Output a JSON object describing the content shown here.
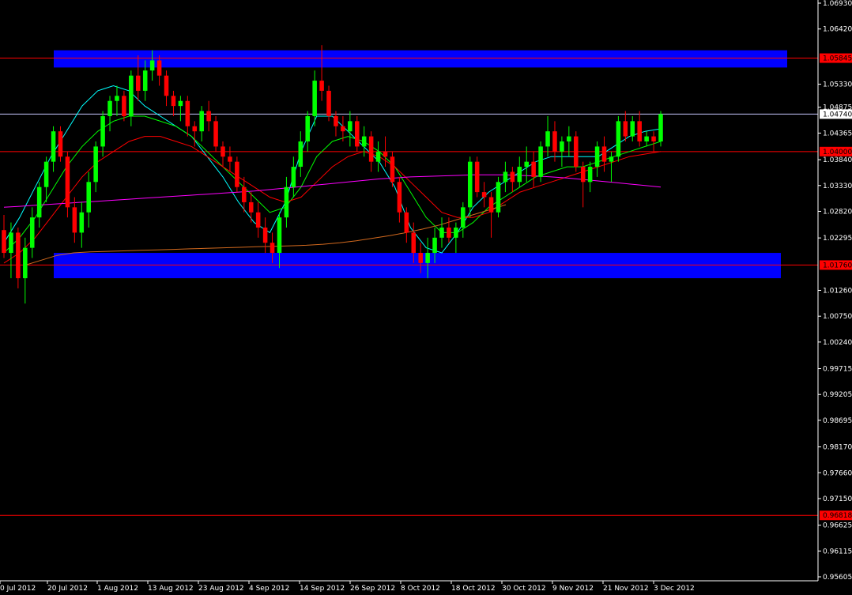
{
  "chart_data": {
    "type": "candlestick",
    "x_tick_labels": [
      "0 Jul 2012",
      "20 Jul 2012",
      "1 Aug 2012",
      "13 Aug 2012",
      "23 Aug 2012",
      "4 Sep 2012",
      "14 Sep 2012",
      "26 Sep 2012",
      "8 Oct 2012",
      "18 Oct 2012",
      "30 Oct 2012",
      "9 Nov 2012",
      "21 Nov 2012",
      "3 Dec 2012"
    ],
    "y_tick_labels": [
      "1.06930",
      "1.06420",
      "1.05330",
      "1.04875",
      "1.04365",
      "1.03840",
      "1.03330",
      "1.02820",
      "1.02295",
      "1.01260",
      "1.00750",
      "1.00240",
      "0.99715",
      "0.99205",
      "0.98695",
      "0.98170",
      "0.97660",
      "0.97150",
      "0.96625",
      "0.96115",
      "0.95605"
    ],
    "ylim": [
      0.95605,
      1.0693
    ],
    "candles": [
      [
        1.0245,
        1.0275,
        1.019,
        1.02
      ],
      [
        1.02,
        1.026,
        1.015,
        1.024
      ],
      [
        1.024,
        1.025,
        1.013,
        1.015
      ],
      [
        1.015,
        1.023,
        1.01,
        1.021
      ],
      [
        1.021,
        1.029,
        1.019,
        1.027
      ],
      [
        1.027,
        1.034,
        1.025,
        1.033
      ],
      [
        1.033,
        1.039,
        1.03,
        1.038
      ],
      [
        1.038,
        1.045,
        1.036,
        1.044
      ],
      [
        1.044,
        1.045,
        1.038,
        1.039
      ],
      [
        1.039,
        1.04,
        1.027,
        1.029
      ],
      [
        1.029,
        1.031,
        1.022,
        1.024
      ],
      [
        1.024,
        1.03,
        1.021,
        1.028
      ],
      [
        1.028,
        1.036,
        1.025,
        1.034
      ],
      [
        1.034,
        1.042,
        1.032,
        1.041
      ],
      [
        1.041,
        1.048,
        1.039,
        1.047
      ],
      [
        1.047,
        1.051,
        1.044,
        1.05
      ],
      [
        1.05,
        1.053,
        1.047,
        1.051
      ],
      [
        1.051,
        1.052,
        1.046,
        1.047
      ],
      [
        1.047,
        1.056,
        1.045,
        1.055
      ],
      [
        1.055,
        1.059,
        1.05,
        1.052
      ],
      [
        1.052,
        1.058,
        1.05,
        1.056
      ],
      [
        1.056,
        1.06,
        1.054,
        1.058
      ],
      [
        1.058,
        1.059,
        1.053,
        1.055
      ],
      [
        1.055,
        1.056,
        1.049,
        1.051
      ],
      [
        1.051,
        1.052,
        1.047,
        1.049
      ],
      [
        1.049,
        1.051,
        1.046,
        1.05
      ],
      [
        1.05,
        1.051,
        1.043,
        1.045
      ],
      [
        1.045,
        1.046,
        1.041,
        1.044
      ],
      [
        1.044,
        1.049,
        1.042,
        1.048
      ],
      [
        1.048,
        1.05,
        1.044,
        1.046
      ],
      [
        1.046,
        1.047,
        1.04,
        1.041
      ],
      [
        1.041,
        1.042,
        1.037,
        1.039
      ],
      [
        1.039,
        1.041,
        1.036,
        1.038
      ],
      [
        1.038,
        1.039,
        1.032,
        1.033
      ],
      [
        1.033,
        1.035,
        1.028,
        1.03
      ],
      [
        1.03,
        1.032,
        1.026,
        1.028
      ],
      [
        1.028,
        1.03,
        1.023,
        1.025
      ],
      [
        1.025,
        1.027,
        1.02,
        1.022
      ],
      [
        1.022,
        1.024,
        1.018,
        1.02
      ],
      [
        1.02,
        1.028,
        1.017,
        1.027
      ],
      [
        1.027,
        1.035,
        1.025,
        1.033
      ],
      [
        1.033,
        1.039,
        1.031,
        1.037
      ],
      [
        1.037,
        1.044,
        1.035,
        1.042
      ],
      [
        1.042,
        1.048,
        1.04,
        1.047
      ],
      [
        1.047,
        1.056,
        1.045,
        1.054
      ],
      [
        1.054,
        1.061,
        1.05,
        1.052
      ],
      [
        1.052,
        1.053,
        1.046,
        1.047
      ],
      [
        1.047,
        1.048,
        1.043,
        1.045
      ],
      [
        1.045,
        1.047,
        1.042,
        1.044
      ],
      [
        1.044,
        1.048,
        1.041,
        1.046
      ],
      [
        1.046,
        1.047,
        1.04,
        1.041
      ],
      [
        1.041,
        1.045,
        1.039,
        1.043
      ],
      [
        1.043,
        1.044,
        1.036,
        1.038
      ],
      [
        1.038,
        1.042,
        1.036,
        1.04
      ],
      [
        1.04,
        1.043,
        1.037,
        1.039
      ],
      [
        1.039,
        1.04,
        1.033,
        1.034
      ],
      [
        1.034,
        1.035,
        1.026,
        1.028
      ],
      [
        1.028,
        1.029,
        1.022,
        1.024
      ],
      [
        1.024,
        1.026,
        1.018,
        1.02
      ],
      [
        1.02,
        1.022,
        1.016,
        1.018
      ],
      [
        1.018,
        1.023,
        1.015,
        1.02
      ],
      [
        1.02,
        1.025,
        1.018,
        1.023
      ],
      [
        1.023,
        1.027,
        1.021,
        1.025
      ],
      [
        1.025,
        1.027,
        1.022,
        1.023
      ],
      [
        1.023,
        1.026,
        1.02,
        1.025
      ],
      [
        1.025,
        1.03,
        1.023,
        1.029
      ],
      [
        1.029,
        1.039,
        1.027,
        1.038
      ],
      [
        1.038,
        1.039,
        1.031,
        1.032
      ],
      [
        1.032,
        1.034,
        1.029,
        1.031
      ],
      [
        1.031,
        1.032,
        1.023,
        1.028
      ],
      [
        1.028,
        1.035,
        1.027,
        1.034
      ],
      [
        1.034,
        1.038,
        1.032,
        1.036
      ],
      [
        1.036,
        1.037,
        1.032,
        1.034
      ],
      [
        1.034,
        1.039,
        1.033,
        1.037
      ],
      [
        1.037,
        1.041,
        1.034,
        1.038
      ],
      [
        1.038,
        1.04,
        1.033,
        1.035
      ],
      [
        1.035,
        1.042,
        1.034,
        1.041
      ],
      [
        1.041,
        1.047,
        1.039,
        1.044
      ],
      [
        1.044,
        1.046,
        1.038,
        1.04
      ],
      [
        1.04,
        1.043,
        1.037,
        1.042
      ],
      [
        1.042,
        1.045,
        1.039,
        1.043
      ],
      [
        1.043,
        1.044,
        1.036,
        1.037
      ],
      [
        1.037,
        1.038,
        1.029,
        1.034
      ],
      [
        1.034,
        1.038,
        1.032,
        1.037
      ],
      [
        1.037,
        1.042,
        1.035,
        1.041
      ],
      [
        1.041,
        1.043,
        1.036,
        1.038
      ],
      [
        1.038,
        1.04,
        1.034,
        1.039
      ],
      [
        1.039,
        1.047,
        1.038,
        1.046
      ],
      [
        1.046,
        1.048,
        1.042,
        1.043
      ],
      [
        1.043,
        1.047,
        1.042,
        1.046
      ],
      [
        1.046,
        1.048,
        1.041,
        1.042
      ],
      [
        1.042,
        1.044,
        1.041,
        1.043
      ],
      [
        1.043,
        1.044,
        1.04,
        1.042
      ],
      [
        1.042,
        1.048,
        1.041,
        1.0474
      ]
    ],
    "moving_averages": [
      {
        "color": "#00ffff",
        "values": [
          1.022,
          1.027,
          1.033,
          1.039,
          1.044,
          1.049,
          1.052,
          1.053,
          1.052,
          1.049,
          1.047,
          1.045,
          1.043,
          1.039,
          1.035,
          1.03,
          1.026,
          1.024,
          1.03,
          1.04,
          1.047,
          1.047,
          1.044,
          1.041,
          1.038,
          1.033,
          1.025,
          1.021,
          1.02,
          1.024,
          1.029,
          1.032,
          1.034,
          1.036,
          1.038,
          1.039,
          1.039,
          1.039,
          1.039,
          1.041,
          1.043,
          1.044,
          1.0445
        ]
      },
      {
        "color": "#00ff00",
        "values": [
          1.02,
          1.023,
          1.027,
          1.032,
          1.037,
          1.041,
          1.044,
          1.046,
          1.047,
          1.047,
          1.046,
          1.045,
          1.043,
          1.04,
          1.037,
          1.034,
          1.031,
          1.028,
          1.029,
          1.033,
          1.039,
          1.042,
          1.043,
          1.042,
          1.04,
          1.037,
          1.032,
          1.027,
          1.024,
          1.024,
          1.026,
          1.029,
          1.031,
          1.033,
          1.035,
          1.036,
          1.037,
          1.037,
          1.038,
          1.039,
          1.04,
          1.041,
          1.042
        ]
      },
      {
        "color": "#ff0000",
        "values": [
          1.018,
          1.02,
          1.023,
          1.027,
          1.031,
          1.035,
          1.038,
          1.04,
          1.042,
          1.043,
          1.043,
          1.042,
          1.041,
          1.039,
          1.037,
          1.035,
          1.033,
          1.031,
          1.03,
          1.031,
          1.034,
          1.037,
          1.039,
          1.04,
          1.039,
          1.037,
          1.034,
          1.031,
          1.028,
          1.027,
          1.027,
          1.028,
          1.03,
          1.032,
          1.033,
          1.034,
          1.035,
          1.036,
          1.037,
          1.038,
          1.039,
          1.0395,
          1.04
        ]
      },
      {
        "color": "#ff00ff",
        "values": [
          1.029,
          1.0292,
          1.0294,
          1.0296,
          1.0298,
          1.03,
          1.0302,
          1.0304,
          1.0306,
          1.0308,
          1.031,
          1.0312,
          1.0314,
          1.0316,
          1.0318,
          1.032,
          1.0322,
          1.0325,
          1.0328,
          1.0331,
          1.0334,
          1.0337,
          1.034,
          1.0343,
          1.0346,
          1.0348,
          1.035,
          1.0351,
          1.0352,
          1.0353,
          1.0354,
          1.0354,
          1.0354,
          1.0353,
          1.0352,
          1.035,
          1.0348,
          1.0345,
          1.0342,
          1.0339,
          1.0336,
          1.0333,
          1.033
        ]
      },
      {
        "color": "#d2691e",
        "values": [
          1.0175,
          1.0185,
          1.0195,
          1.02,
          1.0202,
          1.0203,
          1.0204,
          1.0205,
          1.0206,
          1.0207,
          1.0208,
          1.0209,
          1.021,
          1.0211,
          1.0212,
          1.0213,
          1.0214,
          1.0215,
          1.0217,
          1.022,
          1.0224,
          1.0229,
          1.0234,
          1.024,
          1.0247,
          1.0255,
          1.0265,
          1.0275,
          1.0285,
          1.0295
        ]
      }
    ],
    "resistance_zone": [
      1.0566,
      1.06
    ],
    "support_zone": [
      1.015,
      1.02
    ],
    "horizontal_lines": [
      {
        "value": 1.05845,
        "label": "1.05845",
        "color": "#ff0000",
        "badge": true
      },
      {
        "value": 1.0474,
        "label": "1.04740",
        "color": "#c8c8ff",
        "badge": false
      },
      {
        "value": 1.04,
        "label": "1.04000",
        "color": "#ff0000",
        "badge": true
      },
      {
        "value": 1.0176,
        "label": "1.01760",
        "color": "#ff0000",
        "badge": true
      },
      {
        "value": 0.96818,
        "label": "0.96818",
        "color": "#ff0000",
        "badge": true
      }
    ],
    "colors": {
      "bull": "#00ff00",
      "bear": "#ff0000",
      "zone": "#0000ff",
      "axis": "#ffffff",
      "background": "#000000"
    }
  }
}
